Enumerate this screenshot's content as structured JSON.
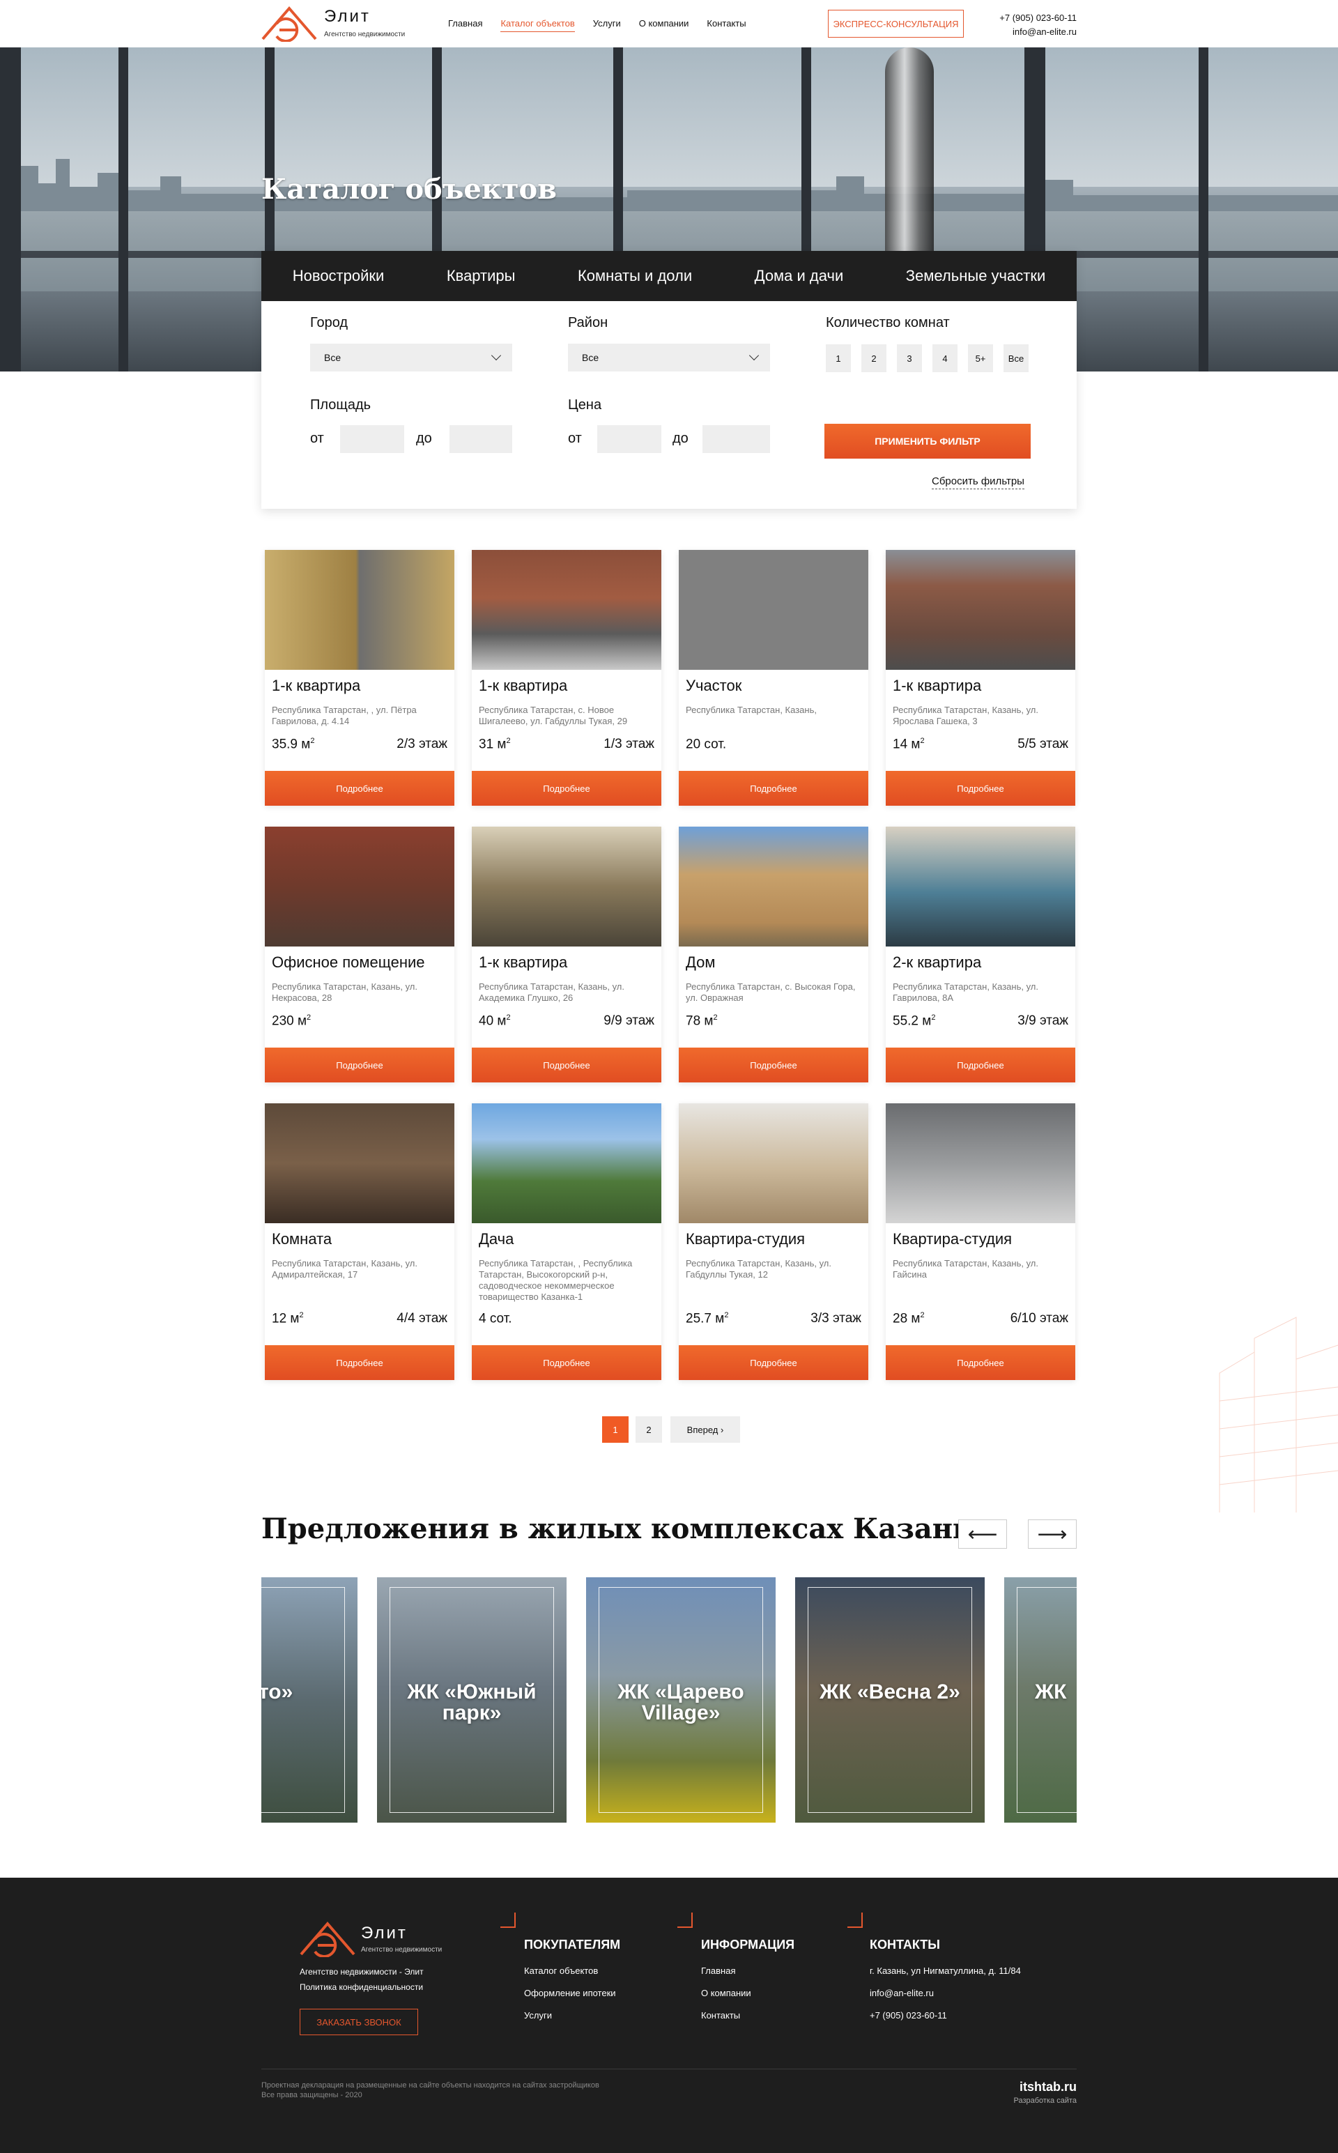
{
  "header": {
    "logo_name": "Элит",
    "logo_sub": "Агентство недвижимости",
    "nav": [
      "Главная",
      "Каталог объектов",
      "Услуги",
      "О компании",
      "Контакты"
    ],
    "consult_button": "ЭКСПРЕСС-КОНСУЛЬТАЦИЯ",
    "phone": "+7 (905) 023-60-11",
    "email": "info@an-elite.ru"
  },
  "hero": {
    "title": "Каталог объектов"
  },
  "filter": {
    "tabs": [
      "Новостройки",
      "Квартиры",
      "Комнаты и доли",
      "Дома и дачи",
      "Земельные участки"
    ],
    "city_label": "Город",
    "city_value": "Все",
    "district_label": "Район",
    "district_value": "Все",
    "rooms_label": "Количество комнат",
    "rooms": [
      "1",
      "2",
      "3",
      "4",
      "5+",
      "Все"
    ],
    "area_label": "Площадь",
    "price_label": "Цена",
    "from": "от",
    "to": "до",
    "apply": "ПРИМЕНИТЬ ФИЛЬТР",
    "reset": "Сбросить фильтры"
  },
  "listings": [
    {
      "title": "1-к квартира",
      "address": "Республика Татарстан, , ул. Пётра Гаврилова, д. 4.14",
      "area": "35.9 м",
      "sup": "2",
      "floor": "2/3 этаж"
    },
    {
      "title": "1-к квартира",
      "address": "Республика Татарстан, с. Новое Шигалеево, ул. Габдуллы Тукая, 29",
      "area": "31 м",
      "sup": "2",
      "floor": "1/3 этаж"
    },
    {
      "title": "Участок",
      "address": "Республика Татарстан, Казань,",
      "area": "20 сот.",
      "sup": "",
      "floor": ""
    },
    {
      "title": "1-к квартира",
      "address": "Республика Татарстан, Казань, ул. Ярослава Гашека, 3",
      "area": "14 м",
      "sup": "2",
      "floor": "5/5 этаж"
    },
    {
      "title": "Офисное помещение",
      "address": "Республика Татарстан, Казань, ул. Некрасова, 28",
      "area": "230 м",
      "sup": "2",
      "floor": ""
    },
    {
      "title": "1-к квартира",
      "address": "Республика Татарстан, Казань, ул. Академика Глушко, 26",
      "area": "40 м",
      "sup": "2",
      "floor": "9/9 этаж"
    },
    {
      "title": "Дом",
      "address": "Республика Татарстан, с. Высокая Гора, ул. Овражная",
      "area": "78 м",
      "sup": "2",
      "floor": ""
    },
    {
      "title": "2-к квартира",
      "address": "Республика Татарстан, Казань, ул. Гаврилова, 8А",
      "area": "55.2 м",
      "sup": "2",
      "floor": "3/9 этаж"
    },
    {
      "title": "Комната",
      "address": "Республика Татарстан, Казань, ул. Адмиралтейская, 17",
      "area": "12 м",
      "sup": "2",
      "floor": "4/4 этаж"
    },
    {
      "title": "Дача",
      "address": "Республика Татарстан, , Республика Татарстан, Высокогорский р-н, садоводческое некоммерческое товарищество Казанка-1",
      "area": "4 сот.",
      "sup": "",
      "floor": ""
    },
    {
      "title": "Квартира-студия",
      "address": "Республика Татарстан, Казань, ул. Габдуллы Тукая, 12",
      "area": "25.7 м",
      "sup": "2",
      "floor": "3/3 этаж"
    },
    {
      "title": "Квартира-студия",
      "address": "Республика Татарстан, Казань, ул. Гайсина",
      "area": "28 м",
      "sup": "2",
      "floor": "6/10 этаж"
    }
  ],
  "more_label": "Подробнее",
  "pagination": {
    "pages": [
      "1",
      "2"
    ],
    "next": "Вперед ›"
  },
  "offers": {
    "title": "Предложения в жилых комплексах Казани",
    "prev": "⟵",
    "next": "⟶",
    "items": [
      "Лето»",
      "ЖК «Южный парк»",
      "ЖК «Царево Village»",
      "ЖК «Весна 2»",
      "ЖК"
    ]
  },
  "footer": {
    "logo_name": "Элит",
    "logo_sub": "Агентство недвижимости",
    "agency": "Агентство недвижимости - Элит",
    "privacy": "Политика конфиденциальности",
    "call": "ЗАКАЗАТЬ ЗВОНОК",
    "buyers_title": "ПОКУПАТЕЛЯМ",
    "buyers": [
      "Каталог объектов",
      "Оформление ипотеки",
      "Услуги"
    ],
    "info_title": "ИНФОРМАЦИЯ",
    "info": [
      "Главная",
      "О компании",
      "Контакты"
    ],
    "contacts_title": "КОНТАКТЫ",
    "contacts": [
      "г. Казань, ул Нигматуллина, д. 11/84",
      "info@an-elite.ru",
      "+7 (905) 023-60-11"
    ],
    "legal1": "Проектная декларация на размещенные на сайте объекты находится на сайтах застройщиков",
    "legal2": "Все права защищены - 2020",
    "dev_name": "itshtab.ru",
    "dev_sub": "Разработка сайта"
  },
  "colors": {
    "accent": "#e4572e",
    "dark": "#1e1e1e"
  }
}
